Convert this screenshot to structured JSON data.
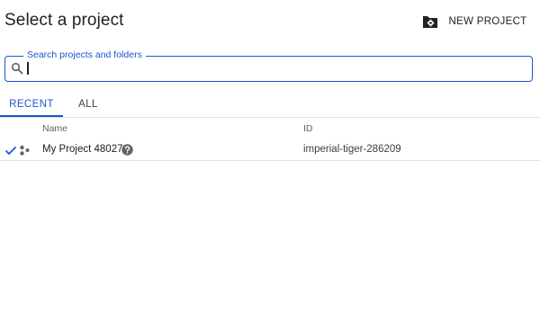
{
  "dialog": {
    "title": "Select a project",
    "new_project_label": "NEW PROJECT"
  },
  "search": {
    "label": "Search projects and folders",
    "value": ""
  },
  "tabs": [
    {
      "label": "RECENT",
      "active": true
    },
    {
      "label": "ALL",
      "active": false
    }
  ],
  "table": {
    "columns": [
      "Name",
      "ID"
    ],
    "rows": [
      {
        "selected": true,
        "name": "My Project 48027",
        "id": "imperial-tiger-286209"
      }
    ]
  },
  "icons": {
    "folder": "create-folder-icon",
    "search": "search-icon",
    "check": "check-icon",
    "org": "organization-icon",
    "help": "help-icon"
  },
  "colors": {
    "accent": "#1a56cc",
    "divider": "#e0e0e0",
    "text": "#202124",
    "muted": "#5f6368"
  }
}
